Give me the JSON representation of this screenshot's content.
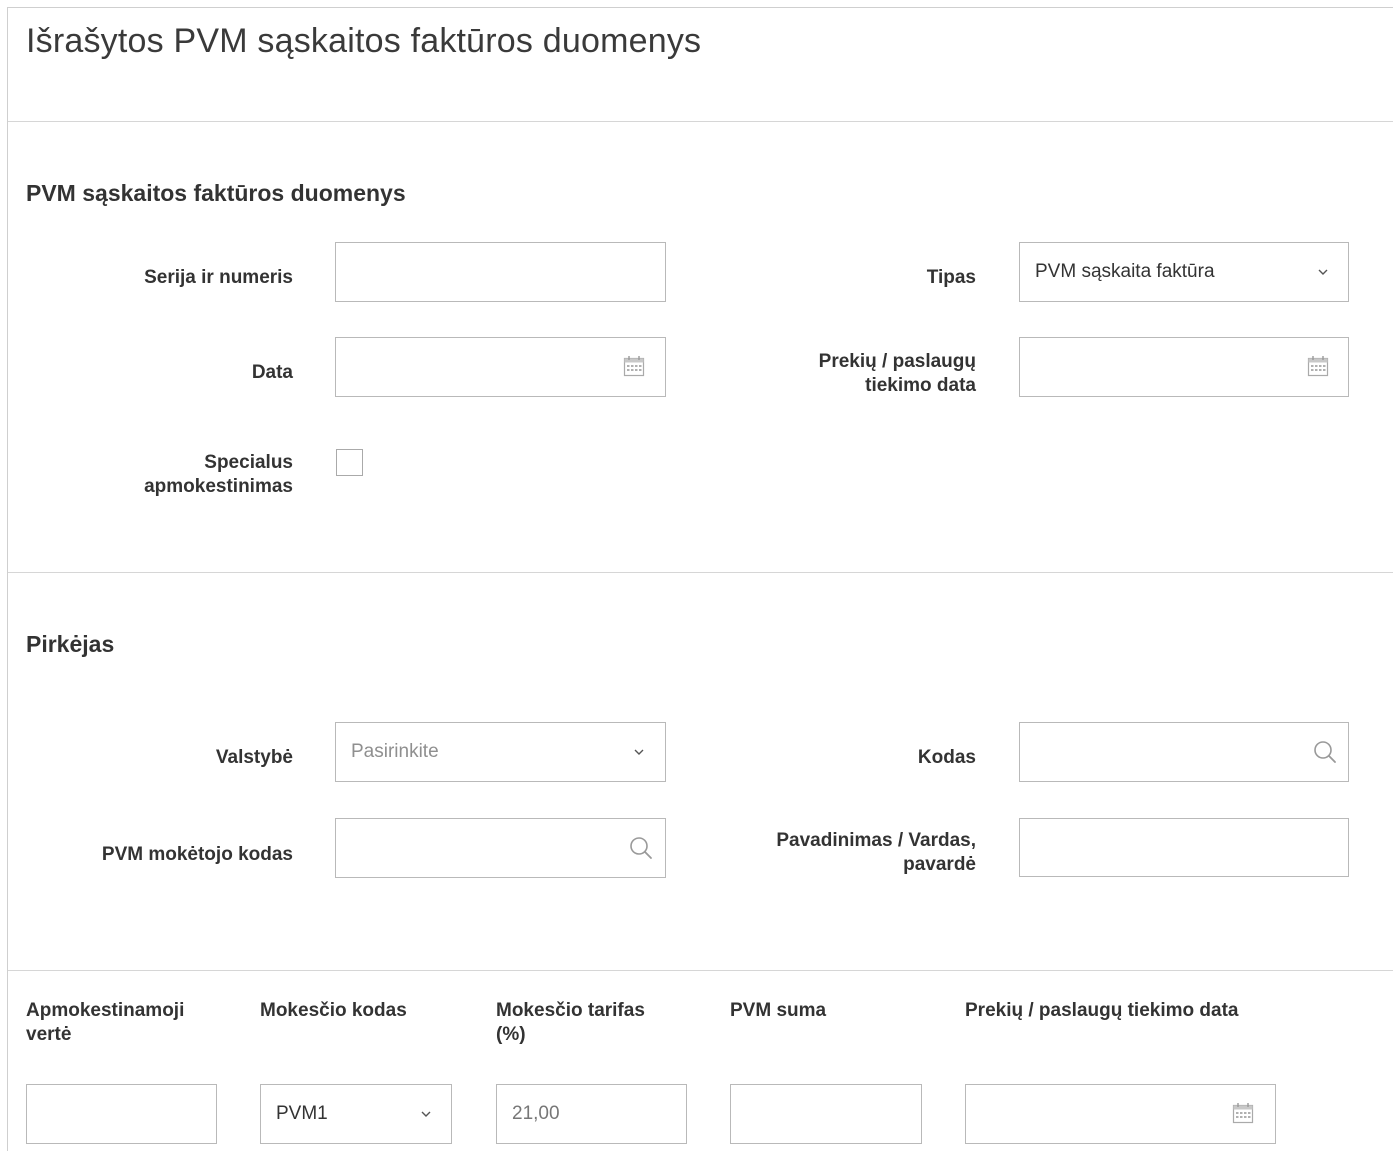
{
  "page": {
    "title": "Išrašytos PVM sąskaitos faktūros duomenys"
  },
  "invoice": {
    "section_title": "PVM sąskaitos faktūros duomenys",
    "series_label": "Serija ir numeris",
    "series_value": "",
    "type_label": "Tipas",
    "type_value": "PVM sąskaita faktūra",
    "date_label": "Data",
    "date_value": "",
    "supply_date_label_line1": "Prekių / paslaugų",
    "supply_date_label_line2": "tiekimo data",
    "supply_date_value": "",
    "special_label_line1": "Specialus",
    "special_label_line2": "apmokestinimas",
    "special_checked": false
  },
  "buyer": {
    "section_title": "Pirkėjas",
    "country_label": "Valstybė",
    "country_placeholder": "Pasirinkite",
    "code_label": "Kodas",
    "code_value": "",
    "vat_code_label": "PVM mokėtojo kodas",
    "vat_code_value": "",
    "name_label_line1": "Pavadinimas / Vardas,",
    "name_label_line2": "pavardė",
    "name_value": ""
  },
  "tax_row": {
    "taxable_label_line1": "Apmokestinamoji",
    "taxable_label_line2": "vertė",
    "taxable_value": "",
    "tax_code_label": "Mokesčio kodas",
    "tax_code_value": "PVM1",
    "tax_rate_label_line1": "Mokesčio tarifas",
    "tax_rate_label_line2": "(%)",
    "tax_rate_value": "21,00",
    "vat_amount_label": "PVM suma",
    "vat_amount_value": "",
    "supply_date_label": "Prekių / paslaugų tiekimo data",
    "supply_date_value": ""
  },
  "icons": {
    "dropdown": "chevron-down-icon",
    "date": "calendar-icon",
    "lookup": "search-icon"
  }
}
